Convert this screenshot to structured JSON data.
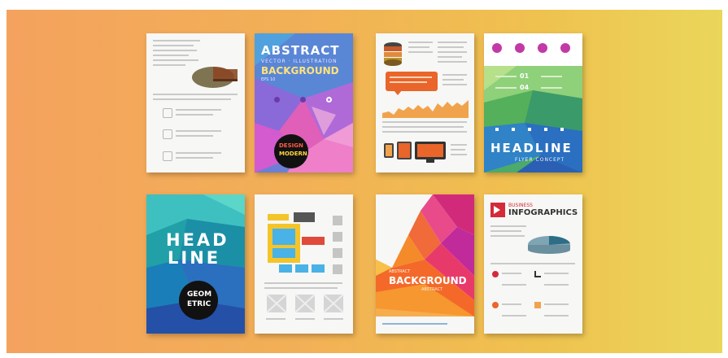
{
  "brochures": {
    "row1_card2": {
      "title": "ABSTRACT",
      "subtitle": "VECTOR · ILLUSTRATION",
      "headline": "BACKGROUND",
      "small": "EPS 10",
      "badge_line1": "DESIGN",
      "badge_line2": "MODERN"
    },
    "row1_card4": {
      "stat_a": "01",
      "stat_b": "04",
      "headline": "HEADLINE",
      "tagline": "FLYER CONCEPT"
    },
    "row2_card1": {
      "line1": "HEAD",
      "line2": "LINE",
      "badge_line1": "GEOM",
      "badge_line2": "ETRIC"
    },
    "row2_card3": {
      "small": "ABSTRACT",
      "headline": "BACKGROUND",
      "sub": "ABSTRACT"
    },
    "row2_card4": {
      "kicker": "BUSINESS",
      "headline": "INFOGRAPHICS"
    }
  },
  "colors": {
    "background_left": "#f4a25e",
    "background_right": "#ead65a",
    "paper": "#f7f7f5"
  }
}
